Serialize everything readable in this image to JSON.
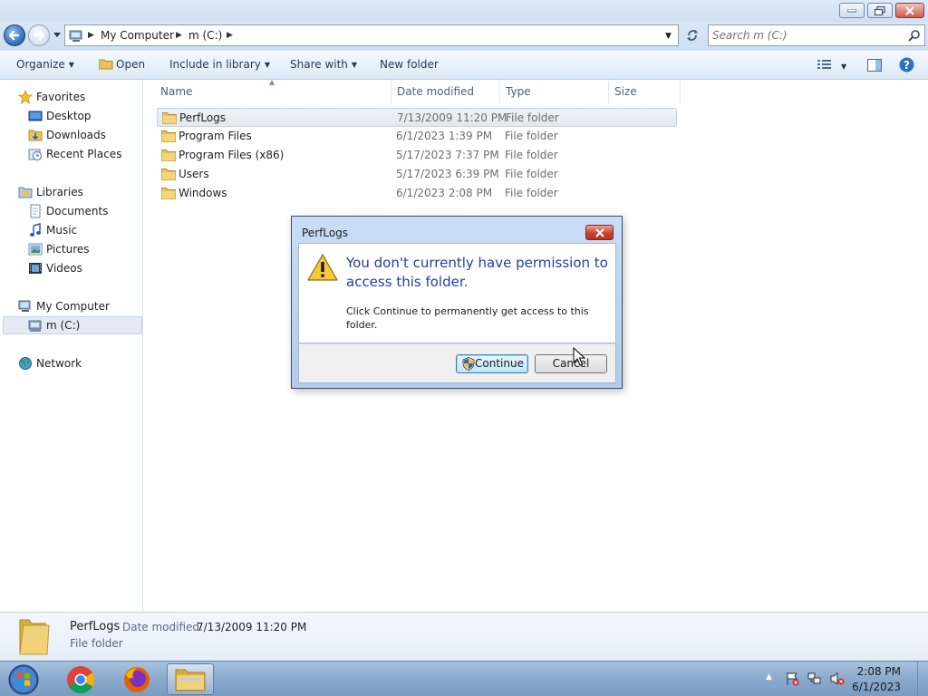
{
  "window": {
    "title": ""
  },
  "address_bar": {
    "crumbs": [
      "My Computer",
      "m (C:)"
    ],
    "search_placeholder": "Search m (C:)"
  },
  "toolbar": {
    "organize": "Organize",
    "open": "Open",
    "include_in_library": "Include in library",
    "share_with": "Share with",
    "new_folder": "New folder"
  },
  "nav": {
    "favorites": "Favorites",
    "favorites_items": [
      "Desktop",
      "Downloads",
      "Recent Places"
    ],
    "libraries": "Libraries",
    "libraries_items": [
      "Documents",
      "Music",
      "Pictures",
      "Videos"
    ],
    "computer": "My Computer",
    "computer_items": [
      "m (C:)"
    ],
    "network": "Network"
  },
  "columns": [
    "Name",
    "Date modified",
    "Type",
    "Size"
  ],
  "files": [
    {
      "name": "PerfLogs",
      "date": "7/13/2009 11:20 PM",
      "type": "File folder",
      "selected": true
    },
    {
      "name": "Program Files",
      "date": "6/1/2023 1:39 PM",
      "type": "File folder"
    },
    {
      "name": "Program Files (x86)",
      "date": "5/17/2023 7:37 PM",
      "type": "File folder"
    },
    {
      "name": "Users",
      "date": "5/17/2023 6:39 PM",
      "type": "File folder"
    },
    {
      "name": "Windows",
      "date": "6/1/2023 2:08 PM",
      "type": "File folder"
    }
  ],
  "details": {
    "name": "PerfLogs",
    "date_label": "Date modified:",
    "date": "7/13/2009 11:20 PM",
    "type": "File folder"
  },
  "dialog": {
    "title": "PerfLogs",
    "heading": "You don't currently have permission to access this folder.",
    "message": "Click Continue to permanently get access to this folder.",
    "continue": "Continue",
    "cancel": "Cancel"
  },
  "taskbar": {
    "time": "2:08 PM",
    "date": "6/1/2023",
    "apps": [
      "chrome-icon",
      "firefox-icon",
      "windows-explorer-icon"
    ]
  },
  "colors": {
    "accent_heading": "#1f3fa8",
    "selection": "#e1e8f0",
    "taskbar": "#8aa9cc"
  }
}
